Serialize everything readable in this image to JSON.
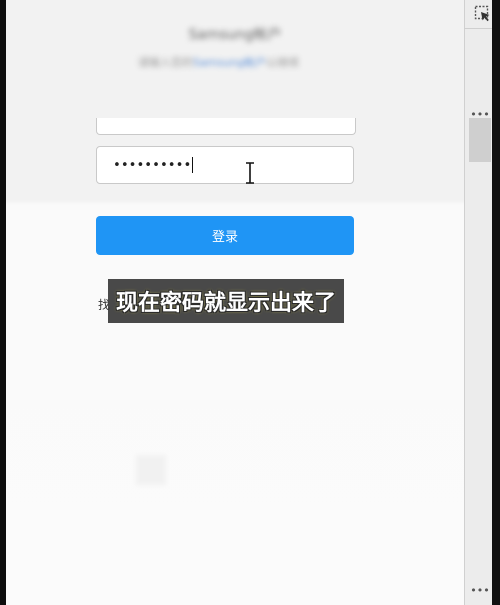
{
  "header": {
    "title": "Samsung帐户",
    "subtitle_prefix": "请输入您的",
    "subtitle_link": "Samsung帐户",
    "subtitle_suffix": "以继续"
  },
  "form": {
    "password_value": "••••••••••",
    "login_label": "登录",
    "left_fragment": "找"
  },
  "caption": {
    "text": "现在密码就显示出来了"
  },
  "devtools": {
    "more_top": "•••",
    "more_bottom": "•••"
  },
  "colors": {
    "primary_button": "#1f95f5",
    "caption_bg": "#3a3a3a"
  },
  "icons": {
    "cursor": "ibeam-icon",
    "inspect": "inspect-element-icon"
  }
}
